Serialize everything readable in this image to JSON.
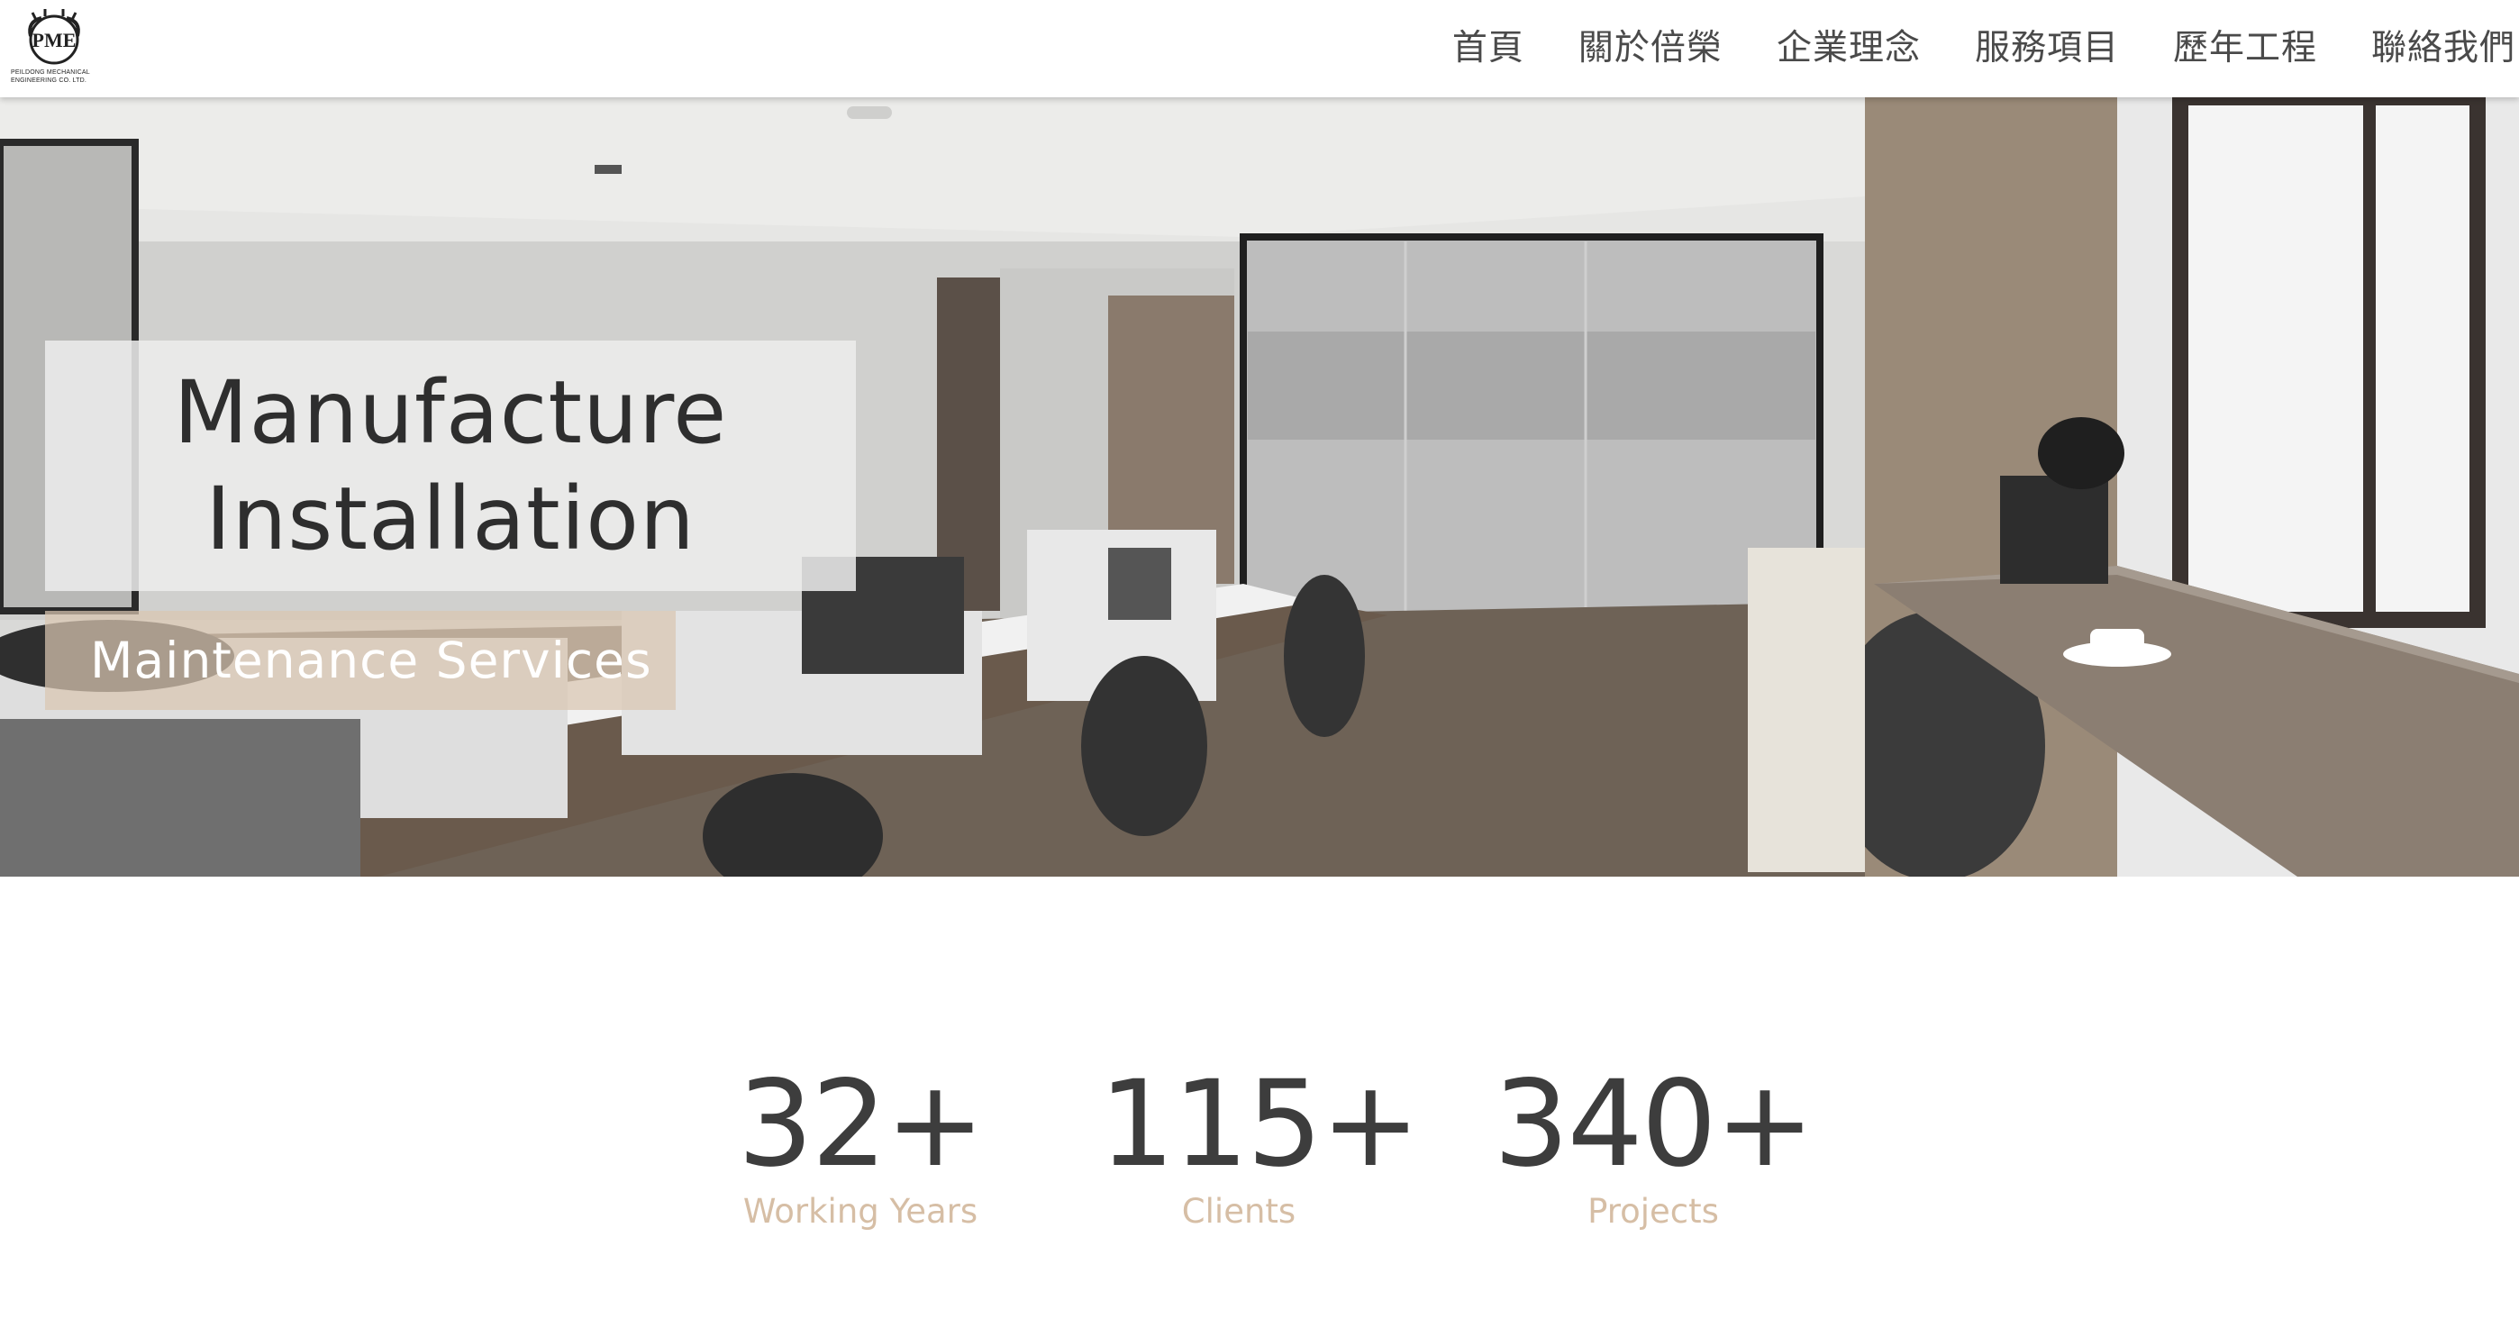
{
  "header": {
    "logo_text_line1": "PEILDONG MECHANICAL",
    "logo_text_line2": "ENGINEERING CO. LTD.",
    "logo_letters": "PME",
    "nav": [
      "首頁",
      "關於倍榮",
      "企業理念",
      "服務項目",
      "歷年工程",
      "聯絡我們"
    ]
  },
  "hero": {
    "title_line1": "Manufacture",
    "title_line2": "Installation",
    "subtitle": "Maintenance Services"
  },
  "stats": [
    {
      "value": "32+",
      "label": "Working Years"
    },
    {
      "value": "115+",
      "label": "Clients"
    },
    {
      "value": "340+",
      "label": "Projects"
    }
  ],
  "colors": {
    "accent_label": "#d6bea5",
    "subtitle_box": "#dac6b2",
    "text_dark": "#3d3d3d"
  }
}
